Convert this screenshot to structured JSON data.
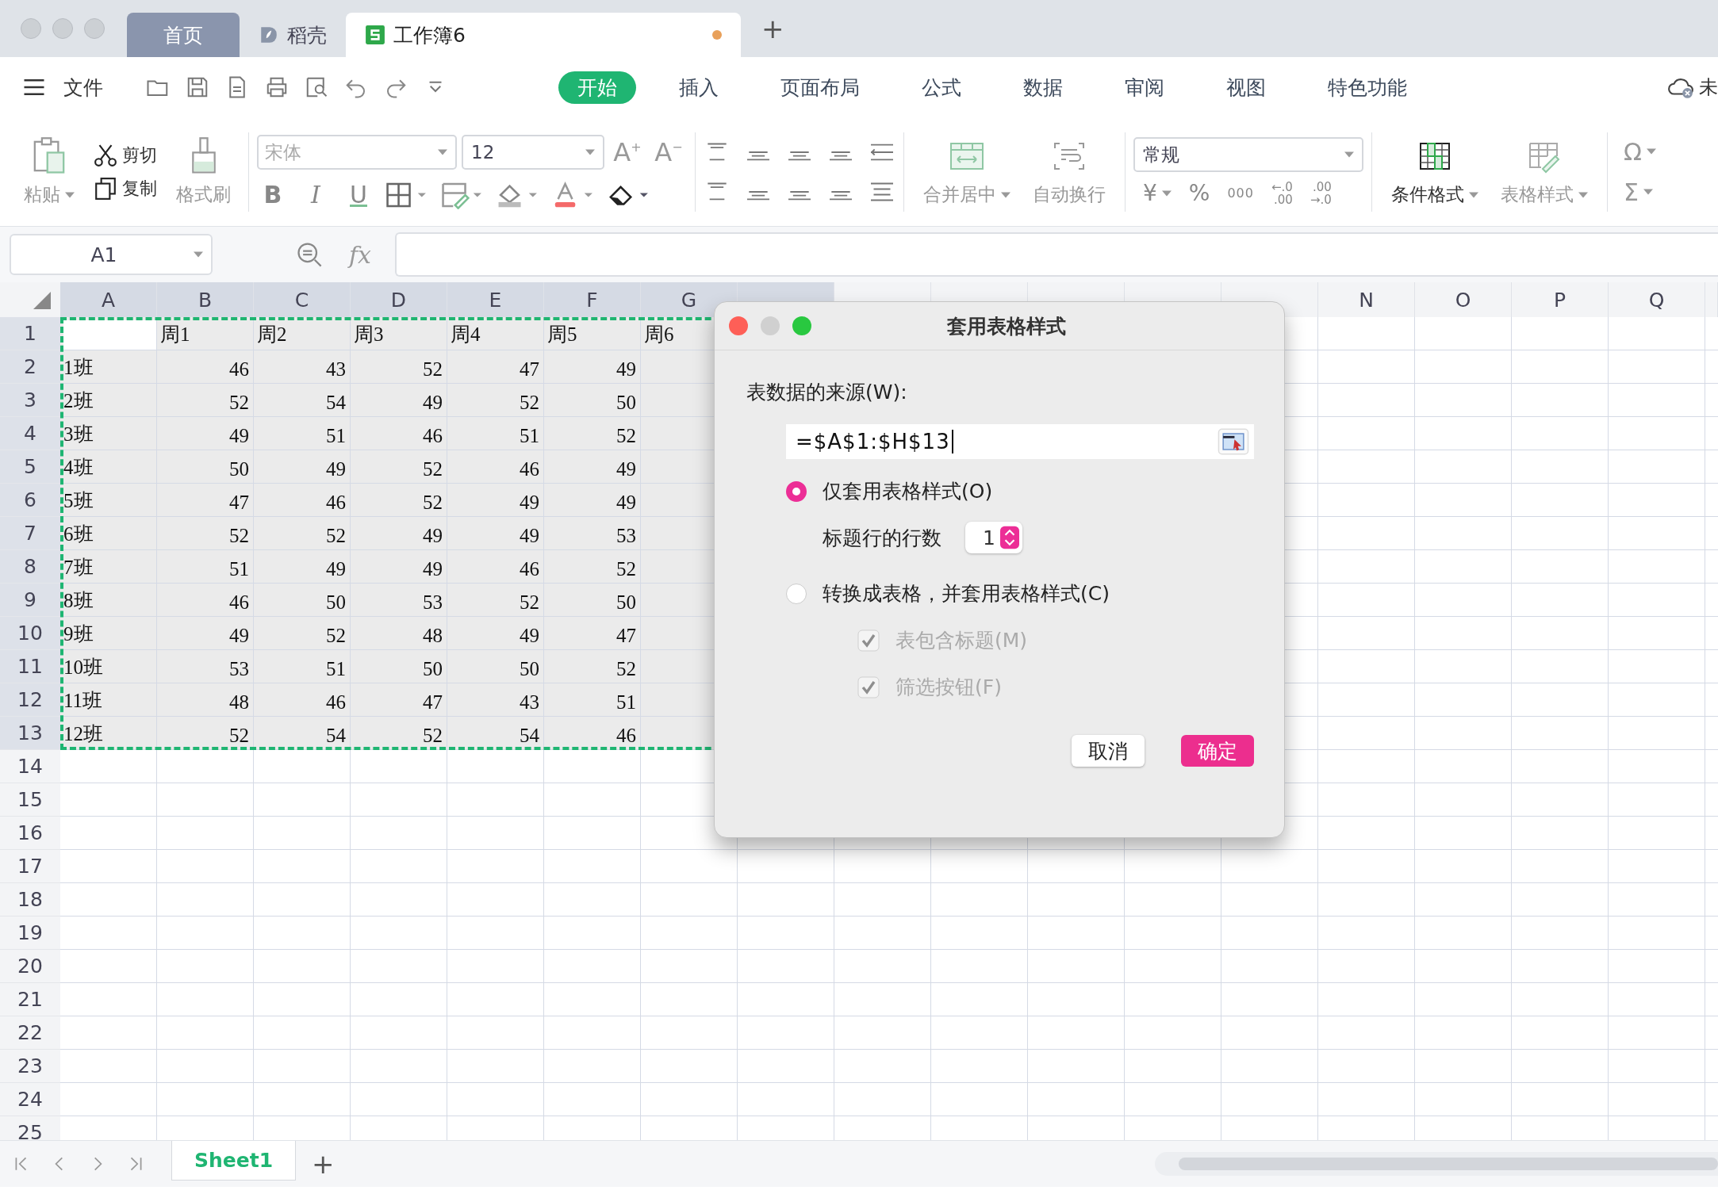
{
  "doc_tabs": [
    {
      "label": "首页",
      "kind": "home",
      "selected": false,
      "unsaved": false
    },
    {
      "label": "稻壳",
      "kind": "docer",
      "selected": false,
      "unsaved": false
    },
    {
      "label": "工作簿6",
      "kind": "sheet",
      "selected": true,
      "unsaved": true
    }
  ],
  "new_tab": "+",
  "menu": {
    "file": "文件",
    "tabs": [
      {
        "label": "开始",
        "selected": true
      },
      {
        "label": "插入",
        "selected": false
      },
      {
        "label": "页面布局",
        "selected": false
      },
      {
        "label": "公式",
        "selected": false
      },
      {
        "label": "数据",
        "selected": false
      },
      {
        "label": "审阅",
        "selected": false
      },
      {
        "label": "视图",
        "selected": false
      },
      {
        "label": "特色功能",
        "selected": false
      }
    ],
    "cloud_status": "未"
  },
  "ribbon": {
    "paste": {
      "label": "粘贴",
      "disabled": true
    },
    "cut": {
      "label": "剪切",
      "disabled": false
    },
    "copy": {
      "label": "复制",
      "disabled": false
    },
    "format_painter": {
      "label": "格式刷",
      "disabled": true
    },
    "font_name": {
      "placeholder": "宋体"
    },
    "font_size": "12",
    "grow_font": "A$^{+}$",
    "shrink_font": "A$^{−}$",
    "bold": "B",
    "italic": "I",
    "underline": "U",
    "merge": {
      "label": "合并居中",
      "disabled": true
    },
    "wrap": {
      "label": "自动换行",
      "disabled": true
    },
    "number_format": "常规",
    "currency": "¥",
    "percent": "%",
    "thousands": "000",
    "decimal_more": [
      "←.0",
      ".00"
    ],
    "decimal_less": [
      ".00",
      "→.0"
    ],
    "conditional_format": {
      "label": "条件格式",
      "disabled": false
    },
    "table_style": {
      "label": "表格样式",
      "disabled": true
    },
    "symbol": "Ω",
    "sum": "Σ"
  },
  "formula_bar": {
    "name_box": "A1",
    "fx": "fx"
  },
  "grid": {
    "columns": [
      {
        "label": "A",
        "selected": true
      },
      {
        "label": "B",
        "selected": true
      },
      {
        "label": "C",
        "selected": true
      },
      {
        "label": "D",
        "selected": true
      },
      {
        "label": "E",
        "selected": true
      },
      {
        "label": "F",
        "selected": true
      },
      {
        "label": "G",
        "selected": true
      },
      {
        "selected": true
      },
      {
        "selected": false
      },
      {
        "selected": false
      },
      {
        "selected": false
      },
      {
        "selected": false
      },
      {
        "selected": false
      },
      {
        "label": "N",
        "selected": false
      },
      {
        "label": "O",
        "selected": false
      },
      {
        "label": "P",
        "selected": false
      },
      {
        "label": "Q",
        "selected": false
      }
    ],
    "rows": [
      {
        "label": "1",
        "kind": "header",
        "selected": true,
        "values": [
          "周1",
          "周2",
          "周3",
          "周4",
          "周5",
          "周6"
        ]
      },
      {
        "label": "2",
        "kind": "data",
        "selected": true,
        "name": "1班",
        "values": [
          "46",
          "43",
          "52",
          "47",
          "49"
        ]
      },
      {
        "label": "3",
        "kind": "data",
        "selected": true,
        "name": "2班",
        "values": [
          "52",
          "54",
          "49",
          "52",
          "50"
        ]
      },
      {
        "label": "4",
        "kind": "data",
        "selected": true,
        "name": "3班",
        "values": [
          "49",
          "51",
          "46",
          "51",
          "52"
        ]
      },
      {
        "label": "5",
        "kind": "data",
        "selected": true,
        "name": "4班",
        "values": [
          "50",
          "49",
          "52",
          "46",
          "49"
        ]
      },
      {
        "label": "6",
        "kind": "data",
        "selected": true,
        "name": "5班",
        "values": [
          "47",
          "46",
          "52",
          "49",
          "49"
        ]
      },
      {
        "label": "7",
        "kind": "data",
        "selected": true,
        "name": "6班",
        "values": [
          "52",
          "52",
          "49",
          "49",
          "53"
        ]
      },
      {
        "label": "8",
        "kind": "data",
        "selected": true,
        "name": "7班",
        "values": [
          "51",
          "49",
          "49",
          "46",
          "52"
        ]
      },
      {
        "label": "9",
        "kind": "data",
        "selected": true,
        "name": "8班",
        "values": [
          "46",
          "50",
          "53",
          "52",
          "50"
        ]
      },
      {
        "label": "10",
        "kind": "data",
        "selected": true,
        "name": "9班",
        "values": [
          "49",
          "52",
          "48",
          "49",
          "47"
        ]
      },
      {
        "label": "11",
        "kind": "data",
        "selected": true,
        "name": "10班",
        "values": [
          "53",
          "51",
          "50",
          "50",
          "52"
        ]
      },
      {
        "label": "12",
        "kind": "data",
        "selected": true,
        "name": "11班",
        "values": [
          "48",
          "46",
          "47",
          "43",
          "51"
        ]
      },
      {
        "label": "13",
        "kind": "data",
        "selected": true,
        "name": "12班",
        "values": [
          "52",
          "54",
          "52",
          "54",
          "46"
        ]
      },
      {
        "label": "14",
        "kind": "empty",
        "selected": false
      },
      {
        "label": "15",
        "kind": "empty",
        "selected": false
      },
      {
        "label": "16",
        "kind": "empty",
        "selected": false
      },
      {
        "label": "17",
        "kind": "empty",
        "selected": false
      },
      {
        "label": "18",
        "kind": "empty",
        "selected": false
      },
      {
        "label": "19",
        "kind": "empty",
        "selected": false
      },
      {
        "label": "20",
        "kind": "empty",
        "selected": false
      },
      {
        "label": "21",
        "kind": "empty",
        "selected": false
      },
      {
        "label": "22",
        "kind": "empty",
        "selected": false
      },
      {
        "label": "23",
        "kind": "empty",
        "selected": false
      },
      {
        "label": "24",
        "kind": "empty",
        "selected": false
      },
      {
        "label": "25",
        "kind": "empty",
        "selected": false
      }
    ]
  },
  "dialog": {
    "title": "套用表格样式",
    "source_label": "表数据的来源(W):",
    "source_value": "=$A$1:$H$13",
    "options": [
      {
        "label": "仅套用表格样式(O)",
        "selected": true
      },
      {
        "label": "转换成表格，并套用表格样式(C)",
        "selected": false
      }
    ],
    "header_rows_label": "标题行的行数",
    "header_rows_value": "1",
    "checkboxes": [
      {
        "label": "表包含标题(M)",
        "checked": true,
        "disabled": true
      },
      {
        "label": "筛选按钮(F)",
        "checked": true,
        "disabled": true
      }
    ],
    "buttons": [
      {
        "label": "取消",
        "kind": "secondary"
      },
      {
        "label": "确定",
        "kind": "primary"
      }
    ]
  },
  "sheet_tabs": [
    {
      "label": "Sheet1",
      "selected": true
    }
  ],
  "add_sheet": "+"
}
